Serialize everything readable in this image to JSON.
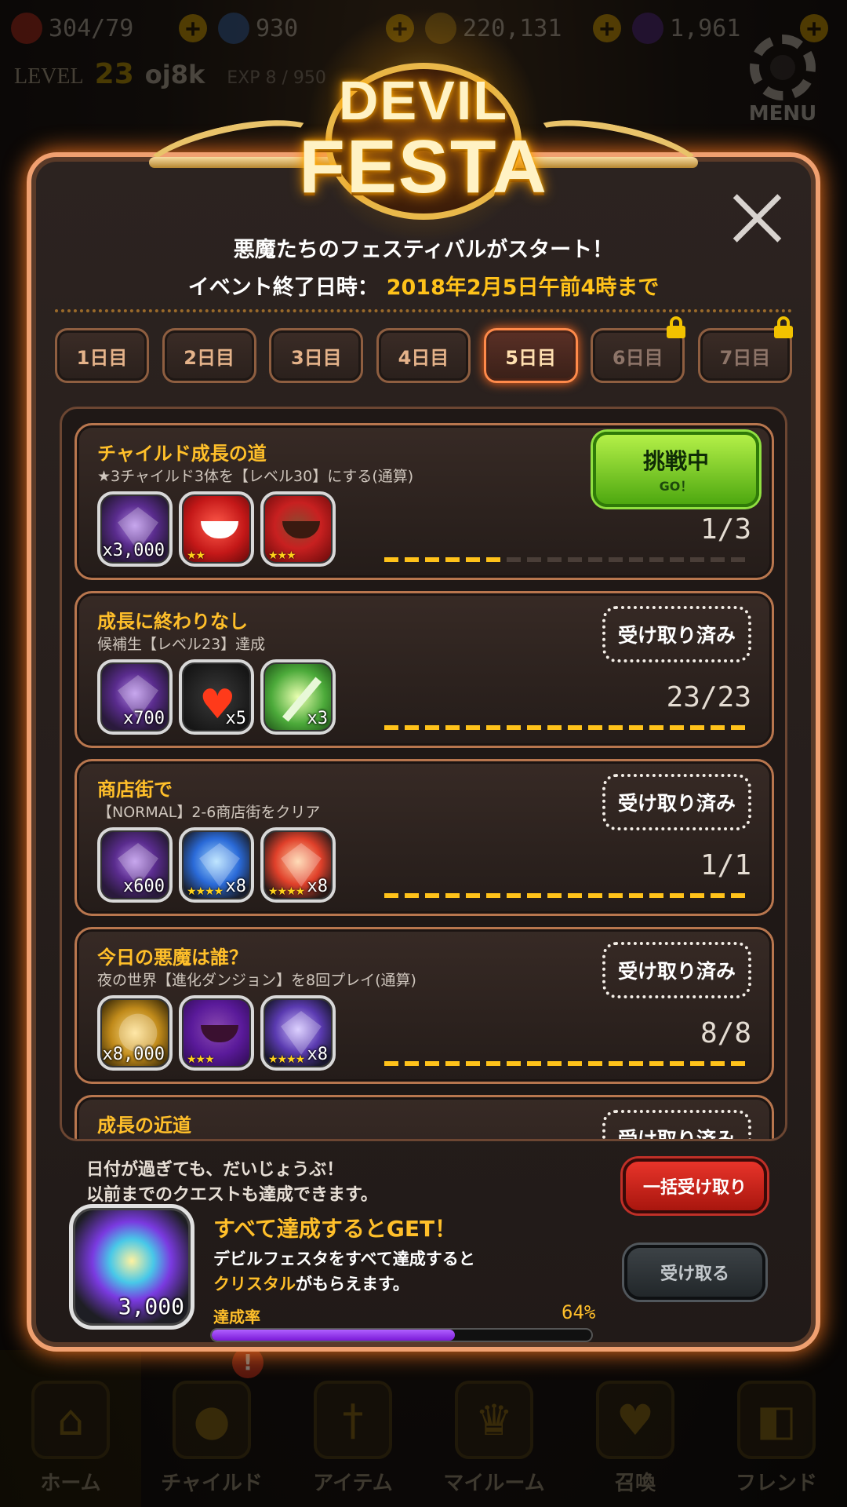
{
  "topbar": {
    "resources": [
      {
        "icon": "heart-icon",
        "value": "304/79",
        "color": "#e0402a"
      },
      {
        "icon": "blue-gem-icon",
        "value": "930",
        "color": "#4a8ad8"
      },
      {
        "icon": "coin-icon",
        "value": "220,131",
        "color": "#d8a020"
      },
      {
        "icon": "purple-gem-icon",
        "value": "1,961",
        "color": "#7a3ab8"
      }
    ],
    "level_label": "LEVEL",
    "level": "23",
    "player_name": "oj8k",
    "exp": "EXP 8 / 950",
    "menu_label": "MENU"
  },
  "logo": {
    "line1": "DEVIL",
    "line2": "FESTA"
  },
  "dialog": {
    "headline": "悪魔たちのフェスティバルがスタート！",
    "end_label": "イベント終了日時：",
    "end_value": "2018年2月5日午前4時まで",
    "tabs": [
      {
        "label": "1日目",
        "state": "normal"
      },
      {
        "label": "2日目",
        "state": "normal"
      },
      {
        "label": "3日目",
        "state": "normal"
      },
      {
        "label": "4日目",
        "state": "normal"
      },
      {
        "label": "5日目",
        "state": "active"
      },
      {
        "label": "6日目",
        "state": "locked"
      },
      {
        "label": "7日目",
        "state": "locked"
      }
    ],
    "quests": [
      {
        "title": "チャイルド成長の道",
        "desc": "★3チャイルド3体を【レベル30】にする(通算)",
        "rewards": [
          {
            "type": "gem-purple",
            "qty": "x3,000",
            "stars": ""
          },
          {
            "type": "red-child",
            "qty": "",
            "stars": "★★"
          },
          {
            "type": "red-knight",
            "qty": "",
            "stars": "★★★"
          }
        ],
        "progress_text": "1/3",
        "progress": 0.333,
        "button": "challenge",
        "button_main": "挑戦中",
        "button_sub": "GO！"
      },
      {
        "title": "成長に終わりなし",
        "desc": "候補生【レベル23】達成",
        "rewards": [
          {
            "type": "gem-purple",
            "qty": "x700",
            "stars": ""
          },
          {
            "type": "heart",
            "qty": "x5",
            "stars": ""
          },
          {
            "type": "ticket",
            "qty": "x3",
            "stars": ""
          }
        ],
        "progress_text": "23/23",
        "progress": 1.0,
        "button": "received",
        "button_main": "受け取り済み"
      },
      {
        "title": "商店街で",
        "desc": "【NORMAL】2-6商店街をクリア",
        "rewards": [
          {
            "type": "gem-purple",
            "qty": "x600",
            "stars": ""
          },
          {
            "type": "gem-blue",
            "qty": "x8",
            "stars": "★★★★"
          },
          {
            "type": "gem-red",
            "qty": "x8",
            "stars": "★★★★"
          }
        ],
        "progress_text": "1/1",
        "progress": 1.0,
        "button": "received",
        "button_main": "受け取り済み"
      },
      {
        "title": "今日の悪魔は誰？",
        "desc": "夜の世界【進化ダンジョン】を8回プレイ(通算)",
        "rewards": [
          {
            "type": "coin",
            "qty": "x8,000",
            "stars": ""
          },
          {
            "type": "purple-child",
            "qty": "",
            "stars": "★★★"
          },
          {
            "type": "gem-violet",
            "qty": "x8",
            "stars": "★★★★"
          }
        ],
        "progress_text": "8/8",
        "progress": 1.0,
        "button": "received",
        "button_main": "受け取り済み"
      },
      {
        "title": "成長の近道",
        "desc": "",
        "rewards": [],
        "progress_text": "",
        "progress": 1.0,
        "button": "received",
        "button_main": "受け取り済み"
      }
    ],
    "note_line1": "日付が過ぎても、だいじょうぶ！",
    "note_line2": "以前までのクエストも達成できます。",
    "grand_reward_qty": "3,000",
    "complete_title": "すべて達成するとGET！",
    "complete_desc1": "デビルフェスタをすべて達成すると",
    "complete_desc2_hl": "クリスタル",
    "complete_desc2_rest": "がもらえます。",
    "rate_label": "達成率",
    "rate_text": "64%",
    "rate": 0.64,
    "btn_bulk": "一括受け取り",
    "btn_receive": "受け取る"
  },
  "bottomnav": {
    "items": [
      {
        "label": "ホーム",
        "active": true
      },
      {
        "label": "チャイルド",
        "active": false
      },
      {
        "label": "アイテム",
        "active": false
      },
      {
        "label": "マイルーム",
        "active": false
      },
      {
        "label": "召喚",
        "active": false
      },
      {
        "label": "フレンド",
        "active": false
      }
    ],
    "badge": "!"
  }
}
